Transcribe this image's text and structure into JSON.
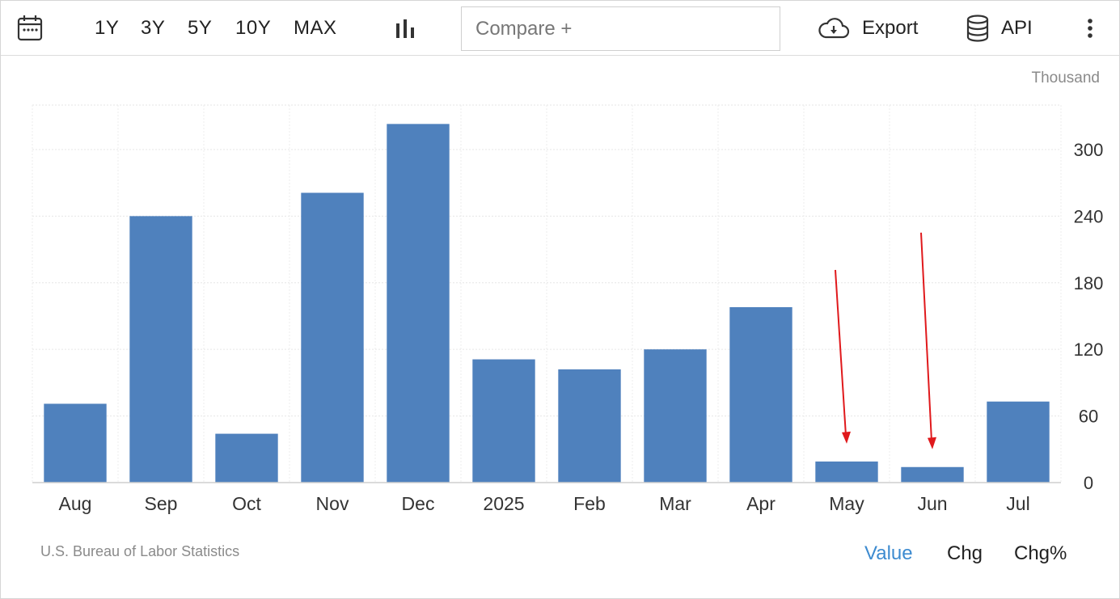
{
  "toolbar": {
    "ranges": [
      "1Y",
      "3Y",
      "5Y",
      "10Y",
      "MAX"
    ],
    "compare_placeholder": "Compare +",
    "export_label": "Export",
    "api_label": "API"
  },
  "chart_data": {
    "type": "bar",
    "unit": "Thousand",
    "categories": [
      "Aug",
      "Sep",
      "Oct",
      "Nov",
      "Dec",
      "2025",
      "Feb",
      "Mar",
      "Apr",
      "May",
      "Jun",
      "Jul"
    ],
    "values": [
      71,
      240,
      44,
      261,
      323,
      111,
      102,
      120,
      158,
      19,
      14,
      73
    ],
    "ylim": [
      0,
      340
    ],
    "yticks": [
      0,
      60,
      120,
      180,
      240,
      300
    ],
    "grid": true,
    "bar_color": "#4f81bd",
    "annotation_color": "#e0191c",
    "annotations": [
      {
        "type": "arrow",
        "target": "May"
      },
      {
        "type": "arrow",
        "target": "Jun"
      }
    ]
  },
  "footer": {
    "source": "U.S. Bureau of Labor Statistics",
    "modes": [
      "Value",
      "Chg",
      "Chg%"
    ],
    "active_mode": "Value"
  }
}
